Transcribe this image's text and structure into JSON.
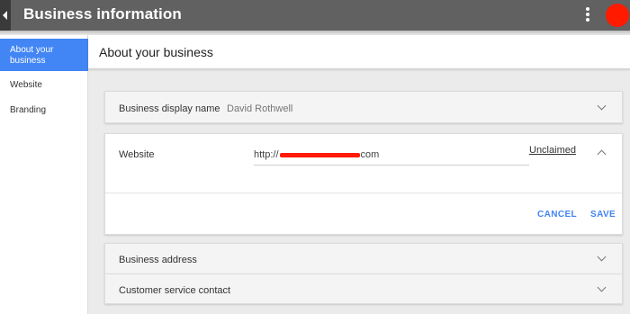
{
  "appbar": {
    "title": "Business information",
    "icons": {
      "back": "back-arrow-icon",
      "more": "more-vert-icon",
      "avatar": "avatar"
    },
    "colors": {
      "bar": "#616161",
      "avatar": "#ff1a00"
    }
  },
  "sidebar": {
    "items": [
      {
        "label": "About your business",
        "active": true
      },
      {
        "label": "Website",
        "active": false
      },
      {
        "label": "Branding",
        "active": false
      }
    ],
    "active_color": "#4285f4"
  },
  "main": {
    "title": "About your business",
    "display_name": {
      "label": "Business display name",
      "value": "David Rothwell"
    },
    "website": {
      "label": "Website",
      "url_prefix": "http://",
      "url_suffix": "com",
      "status": "Unclaimed",
      "cancel_label": "CANCEL",
      "save_label": "SAVE"
    },
    "address": {
      "label": "Business address"
    },
    "customer_service": {
      "label": "Customer service contact"
    }
  }
}
